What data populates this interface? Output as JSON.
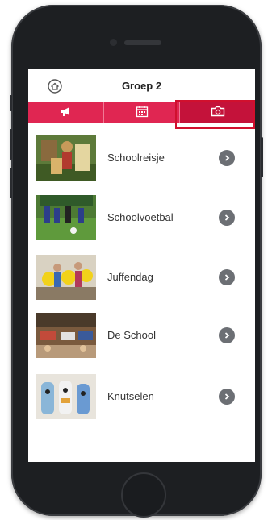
{
  "header": {
    "title": "Groep 2",
    "home_icon": "home-icon"
  },
  "tabs": [
    {
      "icon": "megaphone-icon",
      "active": false
    },
    {
      "icon": "calendar-icon",
      "active": false
    },
    {
      "icon": "camera-icon",
      "active": true
    }
  ],
  "albums": [
    {
      "label": "Schoolreisje",
      "thumb": "photo-scarecrow"
    },
    {
      "label": "Schoolvoetbal",
      "thumb": "photo-soccer"
    },
    {
      "label": "Juffendag",
      "thumb": "photo-kids-balloons"
    },
    {
      "label": "De School",
      "thumb": "photo-classroom"
    },
    {
      "label": "Knutselen",
      "thumb": "photo-crafts"
    }
  ],
  "colors": {
    "tab_bg": "#e02652",
    "tab_active": "#c4123a",
    "chevron": "#6c6f74"
  }
}
